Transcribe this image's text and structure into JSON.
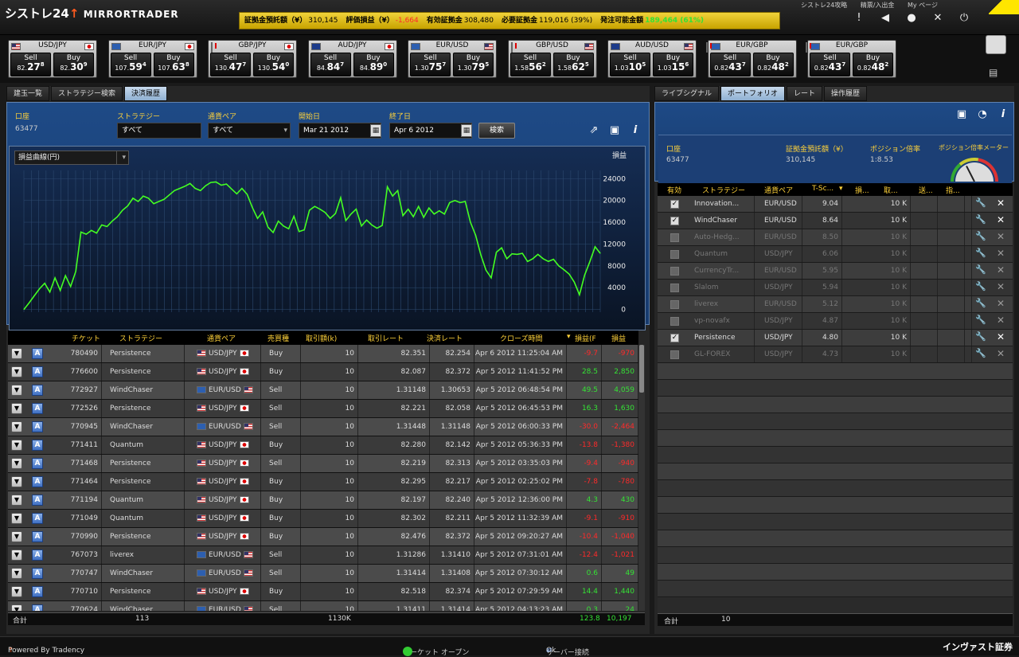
{
  "header": {
    "logo_main": "シストレ24",
    "logo_sub": "MIRRORTRADER",
    "links": [
      "シストレ24攻略",
      "精票/入出金",
      "My ページ"
    ],
    "account_bar": [
      {
        "label": "証拠金預託額（¥）",
        "value": "310,145",
        "tone": "normal"
      },
      {
        "label": "評価損益（¥）",
        "value": "-1,664",
        "tone": "neg"
      },
      {
        "label": "有効証拠金",
        "value": "308,480",
        "tone": "normal"
      },
      {
        "label": "必要証拠金",
        "value": "119,016 (39%)",
        "tone": "normal"
      },
      {
        "label": "発注可能金額",
        "value": "189,464 (61%)",
        "tone": "pos"
      }
    ],
    "icons": [
      "alert-icon",
      "sound-icon",
      "chat-icon",
      "tools-icon",
      "power-icon"
    ]
  },
  "tickers": [
    {
      "pair": "USD/JPY",
      "f1": "us",
      "f2": "jp",
      "sell_label": "Sell",
      "buy_label": "Buy",
      "sell_pre": "82.",
      "sell_big": "27",
      "sell_sup": "8",
      "buy_pre": "82.",
      "buy_big": "30",
      "buy_sup": "9"
    },
    {
      "pair": "EUR/JPY",
      "f1": "eu",
      "f2": "jp",
      "sell_label": "Sell",
      "buy_label": "Buy",
      "sell_pre": "107.",
      "sell_big": "59",
      "sell_sup": "4",
      "buy_pre": "107.",
      "buy_big": "63",
      "buy_sup": "8"
    },
    {
      "pair": "GBP/JPY",
      "f1": "gb",
      "f2": "jp",
      "sell_label": "Sell",
      "buy_label": "Buy",
      "sell_pre": "130.",
      "sell_big": "47",
      "sell_sup": "7",
      "buy_pre": "130.",
      "buy_big": "54",
      "buy_sup": "0"
    },
    {
      "pair": "AUD/JPY",
      "f1": "au",
      "f2": "jp",
      "sell_label": "Sell",
      "buy_label": "Buy",
      "sell_pre": "84.",
      "sell_big": "84",
      "sell_sup": "7",
      "buy_pre": "84.",
      "buy_big": "89",
      "buy_sup": "0"
    },
    {
      "pair": "EUR/USD",
      "f1": "eu",
      "f2": "us",
      "sell_label": "Sell",
      "buy_label": "Buy",
      "sell_pre": "1.30",
      "sell_big": "75",
      "sell_sup": "7",
      "buy_pre": "1.30",
      "buy_big": "79",
      "buy_sup": "5"
    },
    {
      "pair": "GBP/USD",
      "f1": "gb",
      "f2": "us",
      "sell_label": "Sell",
      "buy_label": "Buy",
      "sell_pre": "1.58",
      "sell_big": "56",
      "sell_sup": "2",
      "buy_pre": "1.58",
      "buy_big": "62",
      "buy_sup": "5"
    },
    {
      "pair": "AUD/USD",
      "f1": "au",
      "f2": "us",
      "sell_label": "Sell",
      "buy_label": "Buy",
      "sell_pre": "1.03",
      "sell_big": "10",
      "sell_sup": "5",
      "buy_pre": "1.03",
      "buy_big": "15",
      "buy_sup": "6"
    },
    {
      "pair": "EUR/GBP",
      "f1": "eu",
      "f2": "gb",
      "sell_label": "Sell",
      "buy_label": "Buy",
      "sell_pre": "0.82",
      "sell_big": "43",
      "sell_sup": "7",
      "buy_pre": "0.82",
      "buy_big": "48",
      "buy_sup": "2"
    },
    {
      "pair": "EUR/GBP",
      "f1": "eu",
      "f2": "gb",
      "sell_label": "Sell",
      "buy_label": "Buy",
      "sell_pre": "0.82",
      "sell_big": "43",
      "sell_sup": "7",
      "buy_pre": "0.82",
      "buy_big": "48",
      "buy_sup": "2"
    }
  ],
  "left": {
    "tabs": [
      "建玉一覧",
      "ストラテジー検索",
      "決済履歴"
    ],
    "active_tab": 2,
    "filters": {
      "account_label": "口座",
      "account_value": "63477",
      "strategy_label": "ストラテジー",
      "strategy_value": "すべて",
      "pair_label": "通貨ペア",
      "pair_value": "すべて",
      "start_label": "開始日",
      "start_value": "Mar 21 2012",
      "end_label": "終了日",
      "end_value": "Apr 6 2012",
      "search_button": "検索"
    },
    "chart_select": "損益曲線(円)",
    "columns": [
      "チケット",
      "ストラテジー",
      "通貨ペア",
      "売買種",
      "取引額(k)",
      "取引レート",
      "決済レート",
      "クローズ時間",
      "損益(F",
      "損益"
    ],
    "rows": [
      {
        "ticket": "780490",
        "strategy": "Persistence",
        "f1": "us",
        "f2": "jp",
        "pair": "USD/JPY",
        "side": "Buy",
        "amount": "10",
        "rate": "82.351",
        "close_rate": "82.254",
        "time": "Apr 6 2012 11:25:04 AM",
        "pips": "-9.7",
        "pl": "-970"
      },
      {
        "ticket": "776600",
        "strategy": "Persistence",
        "f1": "us",
        "f2": "jp",
        "pair": "USD/JPY",
        "side": "Buy",
        "amount": "10",
        "rate": "82.087",
        "close_rate": "82.372",
        "time": "Apr 5 2012 11:41:52 PM",
        "pips": "28.5",
        "pl": "2,850"
      },
      {
        "ticket": "772927",
        "strategy": "WindChaser",
        "f1": "eu",
        "f2": "us",
        "pair": "EUR/USD",
        "side": "Sell",
        "amount": "10",
        "rate": "1.31148",
        "close_rate": "1.30653",
        "time": "Apr 5 2012 06:48:54 PM",
        "pips": "49.5",
        "pl": "4,059"
      },
      {
        "ticket": "772526",
        "strategy": "Persistence",
        "f1": "us",
        "f2": "jp",
        "pair": "USD/JPY",
        "side": "Sell",
        "amount": "10",
        "rate": "82.221",
        "close_rate": "82.058",
        "time": "Apr 5 2012 06:45:53 PM",
        "pips": "16.3",
        "pl": "1,630"
      },
      {
        "ticket": "770945",
        "strategy": "WindChaser",
        "f1": "eu",
        "f2": "us",
        "pair": "EUR/USD",
        "side": "Sell",
        "amount": "10",
        "rate": "1.31448",
        "close_rate": "1.31148",
        "time": "Apr 5 2012 06:00:33 PM",
        "pips": "-30.0",
        "pl": "-2,464"
      },
      {
        "ticket": "771411",
        "strategy": "Quantum",
        "f1": "us",
        "f2": "jp",
        "pair": "USD/JPY",
        "side": "Buy",
        "amount": "10",
        "rate": "82.280",
        "close_rate": "82.142",
        "time": "Apr 5 2012 05:36:33 PM",
        "pips": "-13.8",
        "pl": "-1,380"
      },
      {
        "ticket": "771468",
        "strategy": "Persistence",
        "f1": "us",
        "f2": "jp",
        "pair": "USD/JPY",
        "side": "Sell",
        "amount": "10",
        "rate": "82.219",
        "close_rate": "82.313",
        "time": "Apr 5 2012 03:35:03 PM",
        "pips": "-9.4",
        "pl": "-940"
      },
      {
        "ticket": "771464",
        "strategy": "Persistence",
        "f1": "us",
        "f2": "jp",
        "pair": "USD/JPY",
        "side": "Buy",
        "amount": "10",
        "rate": "82.295",
        "close_rate": "82.217",
        "time": "Apr 5 2012 02:25:02 PM",
        "pips": "-7.8",
        "pl": "-780"
      },
      {
        "ticket": "771194",
        "strategy": "Quantum",
        "f1": "us",
        "f2": "jp",
        "pair": "USD/JPY",
        "side": "Buy",
        "amount": "10",
        "rate": "82.197",
        "close_rate": "82.240",
        "time": "Apr 5 2012 12:36:00 PM",
        "pips": "4.3",
        "pl": "430"
      },
      {
        "ticket": "771049",
        "strategy": "Quantum",
        "f1": "us",
        "f2": "jp",
        "pair": "USD/JPY",
        "side": "Buy",
        "amount": "10",
        "rate": "82.302",
        "close_rate": "82.211",
        "time": "Apr 5 2012 11:32:39 AM",
        "pips": "-9.1",
        "pl": "-910"
      },
      {
        "ticket": "770990",
        "strategy": "Persistence",
        "f1": "us",
        "f2": "jp",
        "pair": "USD/JPY",
        "side": "Buy",
        "amount": "10",
        "rate": "82.476",
        "close_rate": "82.372",
        "time": "Apr 5 2012 09:20:27 AM",
        "pips": "-10.4",
        "pl": "-1,040"
      },
      {
        "ticket": "767073",
        "strategy": "liverex",
        "f1": "eu",
        "f2": "us",
        "pair": "EUR/USD",
        "side": "Sell",
        "amount": "10",
        "rate": "1.31286",
        "close_rate": "1.31410",
        "time": "Apr 5 2012 07:31:01 AM",
        "pips": "-12.4",
        "pl": "-1,021"
      },
      {
        "ticket": "770747",
        "strategy": "WindChaser",
        "f1": "eu",
        "f2": "us",
        "pair": "EUR/USD",
        "side": "Sell",
        "amount": "10",
        "rate": "1.31414",
        "close_rate": "1.31408",
        "time": "Apr 5 2012 07:30:12 AM",
        "pips": "0.6",
        "pl": "49"
      },
      {
        "ticket": "770710",
        "strategy": "Persistence",
        "f1": "us",
        "f2": "jp",
        "pair": "USD/JPY",
        "side": "Buy",
        "amount": "10",
        "rate": "82.518",
        "close_rate": "82.374",
        "time": "Apr 5 2012 07:29:59 AM",
        "pips": "14.4",
        "pl": "1,440"
      },
      {
        "ticket": "770624",
        "strategy": "WindChaser",
        "f1": "eu",
        "f2": "us",
        "pair": "EUR/USD",
        "side": "Sell",
        "amount": "10",
        "rate": "1.31411",
        "close_rate": "1.31414",
        "time": "Apr 5 2012 04:13:23 AM",
        "pips": "0.3",
        "pl": "24"
      }
    ],
    "footer": {
      "label": "合計",
      "count": "113",
      "amount": "1130K",
      "pips": "123.8",
      "pl": "10,197"
    }
  },
  "chart_data": {
    "type": "line",
    "title": "",
    "xlabel": "",
    "ylabel": "損益",
    "ylim": [
      -500,
      25500
    ],
    "yticks": [
      "0",
      "4000",
      "8000",
      "12000",
      "16000",
      "20000",
      "24000"
    ],
    "grid": true,
    "series": [
      {
        "values": [
          0,
          1200,
          2500,
          3800,
          4800,
          3200,
          5800,
          3500,
          6200,
          4200,
          7000,
          14200,
          13800,
          14500,
          14000,
          15500,
          15200,
          16200,
          17000,
          18200,
          19000,
          20400,
          19800,
          20800,
          20400,
          19400,
          19800,
          20200,
          21000,
          21800,
          22200,
          22600,
          23100,
          22200,
          21800,
          22700,
          23300,
          23400,
          22800,
          23000,
          22100,
          21200,
          22200,
          21100,
          18700,
          16700,
          17900,
          15100,
          14100,
          16200,
          15300,
          14800,
          17100,
          14300,
          14600,
          18200,
          18900,
          18400,
          17800,
          16700,
          17600,
          20500,
          16300,
          17500,
          18400,
          15300,
          16400,
          15500,
          14900,
          15400,
          22500,
          20800,
          21800,
          17200,
          18400,
          17000,
          18900,
          16900,
          18600,
          17500,
          18100,
          17500,
          19600,
          20000,
          19600,
          19800,
          16000,
          13600,
          10000,
          7200,
          5800,
          10500,
          11300,
          9300,
          10200,
          10100,
          10300,
          8800,
          9300,
          10100,
          9300,
          8800,
          9200,
          8000,
          7300,
          6500,
          5000,
          2700,
          6300,
          8800,
          11500,
          10300
        ]
      }
    ]
  },
  "right": {
    "tabs": [
      "ライブシグナル",
      "ポートフォリオ",
      "レート",
      "操作履歴"
    ],
    "active_tab": 1,
    "info": {
      "account_label": "口座",
      "account_value": "63477",
      "deposit_label": "証拠金預託額（¥）",
      "deposit_value": "310,145",
      "leverage_label": "ポジション倍率",
      "leverage_value": "1:8.53",
      "meter_label": "ポジション倍率メーター",
      "meter_level": 0.35
    },
    "columns": [
      "有効",
      "ストラテジー",
      "通貨ペア",
      "T-Sc...",
      "損...",
      "取...",
      "送...",
      "指..."
    ],
    "rows": [
      {
        "active": true,
        "name": "Innovation...",
        "pair": "EUR/USD",
        "score": "9.04",
        "size": "10 K"
      },
      {
        "active": true,
        "name": "WindChaser",
        "pair": "EUR/USD",
        "score": "8.64",
        "size": "10 K"
      },
      {
        "active": false,
        "name": "Auto-Hedg...",
        "pair": "EUR/USD",
        "score": "8.50",
        "size": "10 K"
      },
      {
        "active": false,
        "name": "Quantum",
        "pair": "USD/JPY",
        "score": "6.06",
        "size": "10 K"
      },
      {
        "active": false,
        "name": "CurrencyTr...",
        "pair": "EUR/USD",
        "score": "5.95",
        "size": "10 K"
      },
      {
        "active": false,
        "name": "Slalom",
        "pair": "USD/JPY",
        "score": "5.94",
        "size": "10 K"
      },
      {
        "active": false,
        "name": "liverex",
        "pair": "EUR/USD",
        "score": "5.12",
        "size": "10 K"
      },
      {
        "active": false,
        "name": "vp-novafx",
        "pair": "USD/JPY",
        "score": "4.87",
        "size": "10 K"
      },
      {
        "active": true,
        "name": "Persistence",
        "pair": "USD/JPY",
        "score": "4.80",
        "size": "10 K"
      },
      {
        "active": false,
        "name": "GL-FOREX",
        "pair": "USD/JPY",
        "score": "4.73",
        "size": "10 K"
      }
    ],
    "footer": {
      "label": "合計",
      "count": "10"
    }
  },
  "status": {
    "powered": "Powered By Tradency",
    "market": "マーケット オープン",
    "server": "サーバー接続",
    "server_value": "Ok",
    "brand": "インヴァスト証券"
  }
}
